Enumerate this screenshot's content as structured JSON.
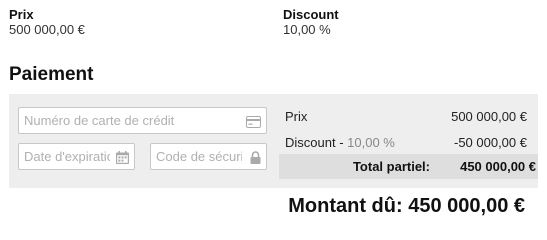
{
  "summary": {
    "price_label": "Prix",
    "price_value": "500 000,00 €",
    "discount_label": "Discount",
    "discount_value": "10,00 %"
  },
  "payment": {
    "title": "Paiement",
    "card_number_placeholder": "Numéro de carte de crédit",
    "expiry_placeholder": "Date d'expiration",
    "security_code_placeholder": "Code de sécurité",
    "breakdown": {
      "price_label": "Prix",
      "price_value": "500 000,00 €",
      "discount_label": "Discount -",
      "discount_percent": "10,00 %",
      "discount_value": "-50 000,00 €",
      "subtotal_label": "Total partiel:",
      "subtotal_value": "450 000,00 €"
    }
  },
  "amount_due": {
    "label": "Montant dû:",
    "value": "450 000,00 €"
  },
  "icons": {
    "card": "credit-card-icon",
    "calendar": "calendar-icon",
    "lock": "lock-icon"
  },
  "colors": {
    "panel_bg": "#eeeeee",
    "subtotal_bg": "#dedede"
  }
}
